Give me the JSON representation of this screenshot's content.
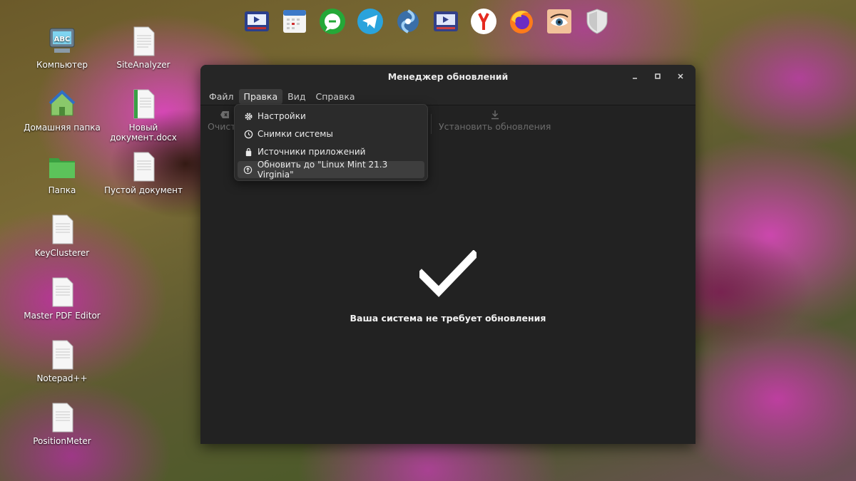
{
  "window": {
    "title": "Менеджер обновлений",
    "menu": [
      "Файл",
      "Правка",
      "Вид",
      "Справка"
    ],
    "active_menu_index": 1,
    "toolbar": {
      "clear_label": "Очисти",
      "install_label": "Установить обновления"
    },
    "status_text": "Ваша система не требует обновления"
  },
  "dropdown": {
    "items": [
      {
        "label": "Настройки",
        "icon": "gear-icon"
      },
      {
        "label": "Снимки системы",
        "icon": "clock-icon"
      },
      {
        "label": "Источники приложений",
        "icon": "bag-icon"
      },
      {
        "label": "Обновить до \"Linux Mint 21.3 Virginia\"",
        "icon": "upgrade-icon"
      }
    ],
    "highlighted_index": 3
  },
  "desktop_icons": [
    {
      "label": "Компьютер",
      "icon": "computer-icon"
    },
    {
      "label": "SiteAnalyzer",
      "icon": "document-icon"
    },
    {
      "label": "Домашняя папка",
      "icon": "home-folder-icon"
    },
    {
      "label": "Новый документ.docx",
      "icon": "docx-icon"
    },
    {
      "label": "Папка",
      "icon": "folder-icon"
    },
    {
      "label": "Пустой документ",
      "icon": "document-icon"
    },
    {
      "label": "KeyClusterer",
      "icon": "document-icon"
    },
    {
      "label": "Master PDF Editor",
      "icon": "document-icon"
    },
    {
      "label": "Notepad++",
      "icon": "document-icon"
    },
    {
      "label": "PositionMeter",
      "icon": "document-icon"
    }
  ],
  "dock": [
    "video-player-icon",
    "calendar-icon",
    "chat-icon",
    "telegram-icon",
    "swirl-app-icon",
    "video-editor-icon",
    "yandex-browser-icon",
    "firefox-icon",
    "eye-app-icon",
    "shield-icon"
  ],
  "colors": {
    "window_bg": "#222222",
    "wallpaper_accent": "#d046b4"
  }
}
